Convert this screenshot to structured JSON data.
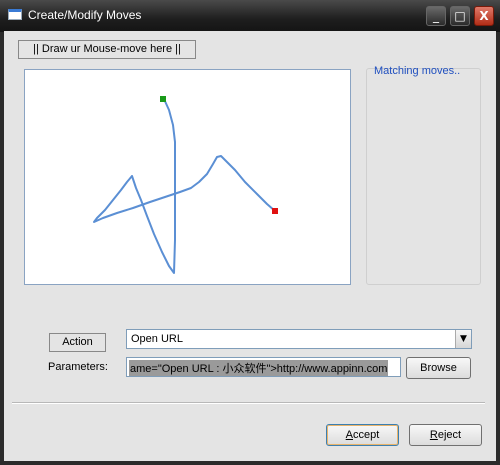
{
  "window": {
    "title": "Create/Modify Moves"
  },
  "titlebar_buttons": {
    "minimize": "_",
    "maximize": "□",
    "close": "X"
  },
  "draw_tab": {
    "label": "|| Draw ur Mouse-move here ||"
  },
  "matching": {
    "label": "Matching moves.."
  },
  "action": {
    "label": "Action",
    "selected": "Open URL"
  },
  "parameters": {
    "label": "Parameters:",
    "value": "ame=\"Open URL : 小众软件\">http://www.appinn.com"
  },
  "buttons": {
    "browse": "Browse",
    "accept_first": "A",
    "accept_rest": "ccept",
    "reject_first": "R",
    "reject_rest": "eject"
  },
  "colors": {
    "stroke": "#5b8fd4",
    "start_marker": "#1a9a1a",
    "end_marker": "#e01010",
    "link_text": "#1f4fbf"
  }
}
